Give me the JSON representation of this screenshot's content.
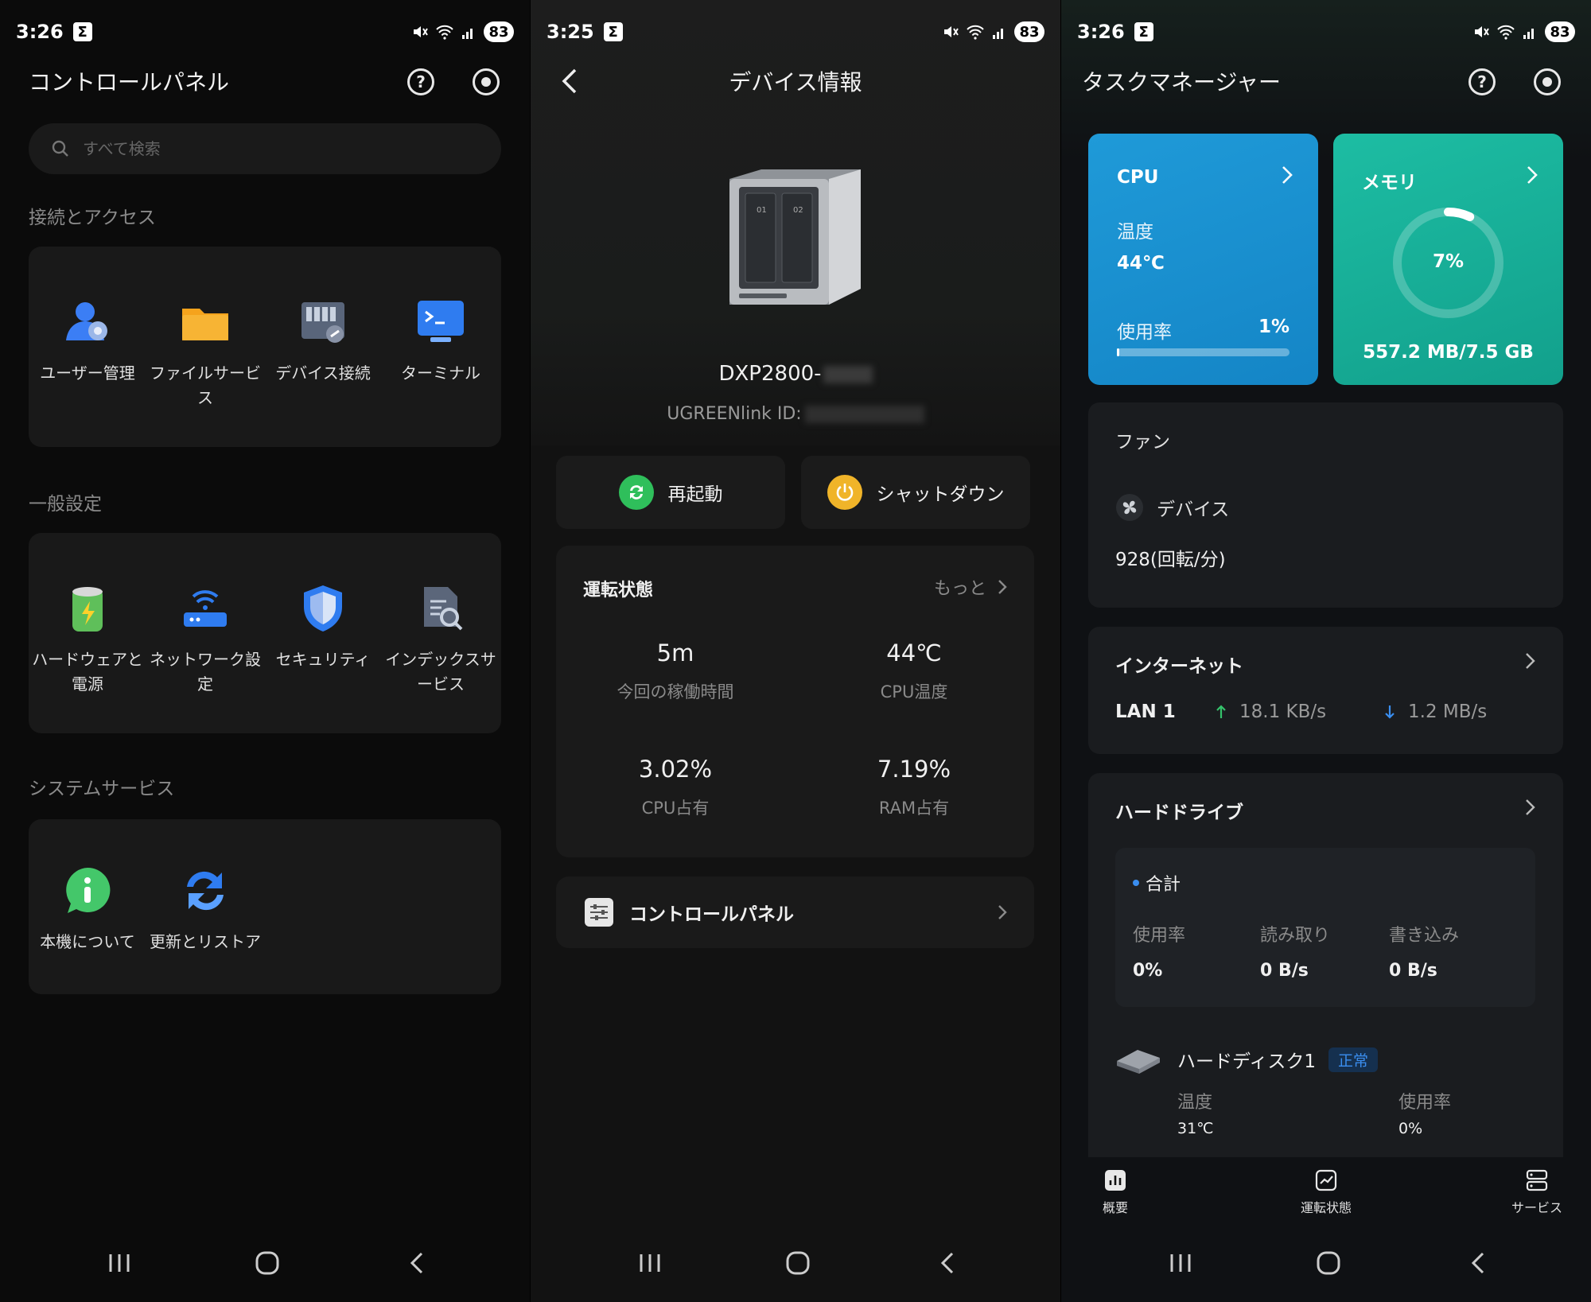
{
  "screen1": {
    "status": {
      "time": "3:26",
      "battery": "83"
    },
    "title": "コントロールパネル",
    "help_symbol": "?",
    "search": {
      "placeholder": "すべて検索"
    },
    "sections": [
      {
        "label": "接続とアクセス",
        "items": [
          {
            "label": "ユーザー管理",
            "icon": "users-icon"
          },
          {
            "label": "ファイルサービス",
            "icon": "folder-icon"
          },
          {
            "label": "デバイス接続",
            "icon": "device-link-icon"
          },
          {
            "label": "ターミナル",
            "icon": "terminal-icon"
          }
        ]
      },
      {
        "label": "一般設定",
        "items": [
          {
            "label": "ハードウェアと電源",
            "icon": "battery-icon"
          },
          {
            "label": "ネットワーク設定",
            "icon": "router-icon"
          },
          {
            "label": "セキュリティ",
            "icon": "shield-icon"
          },
          {
            "label": "インデックスサービス",
            "icon": "index-search-icon"
          }
        ]
      },
      {
        "label": "システムサービス",
        "items": [
          {
            "label": "本機について",
            "icon": "info-icon"
          },
          {
            "label": "更新とリストア",
            "icon": "refresh-icon"
          }
        ]
      }
    ]
  },
  "screen2": {
    "status": {
      "time": "3:25",
      "battery": "83"
    },
    "title": "デバイス情報",
    "model": "DXP2800-",
    "ugreenlink_label": "UGREENlink ID:",
    "restart_label": "再起動",
    "shutdown_label": "シャットダウン",
    "running": {
      "title": "運転状態",
      "more": "もっと",
      "uptime_value": "5m",
      "uptime_label": "今回の稼働時間",
      "cpu_temp_value": "44℃",
      "cpu_temp_label": "CPU温度",
      "cpu_usage_value": "3.02%",
      "cpu_usage_label": "CPU占有",
      "ram_usage_value": "7.19%",
      "ram_usage_label": "RAM占有"
    },
    "control_panel_label": "コントロールパネル"
  },
  "screen3": {
    "status": {
      "time": "3:26",
      "battery": "83"
    },
    "title": "タスクマネージャー",
    "cpu": {
      "title": "CPU",
      "temp_label": "温度",
      "temp_value": "44℃",
      "usage_label": "使用率",
      "usage_value": "1%",
      "usage_fraction": 0.01
    },
    "memory": {
      "title": "メモリ",
      "percent": "7%",
      "fraction": 0.07,
      "detail": "557.2 MB/7.5 GB"
    },
    "fan": {
      "title": "ファン",
      "device_label": "デバイス",
      "speed": "928(回転/分)"
    },
    "internet": {
      "title": "インターネット",
      "lan": "LAN 1",
      "up": "18.1 KB/s",
      "down": "1.2 MB/s"
    },
    "drives": {
      "title": "ハードドライブ",
      "total_label": "合計",
      "usage_label": "使用率",
      "usage_value": "0%",
      "read_label": "読み取り",
      "read_value": "0 B/s",
      "write_label": "書き込み",
      "write_value": "0 B/s",
      "disk_name": "ハードディスク1",
      "disk_status": "正常",
      "disk_temp_label": "温度",
      "disk_temp_value": "31℃",
      "disk_usage_label": "使用率",
      "disk_usage_value": "0%"
    },
    "tabs": [
      "概要",
      "運転状態",
      "サービス"
    ]
  },
  "colors": {
    "cpu_card": "#1f9ad8",
    "mem_card": "#1dbda3",
    "restart_green": "#2fbf5b",
    "shutdown_orange": "#f0b429",
    "status_ok": "#3a8ef0"
  }
}
